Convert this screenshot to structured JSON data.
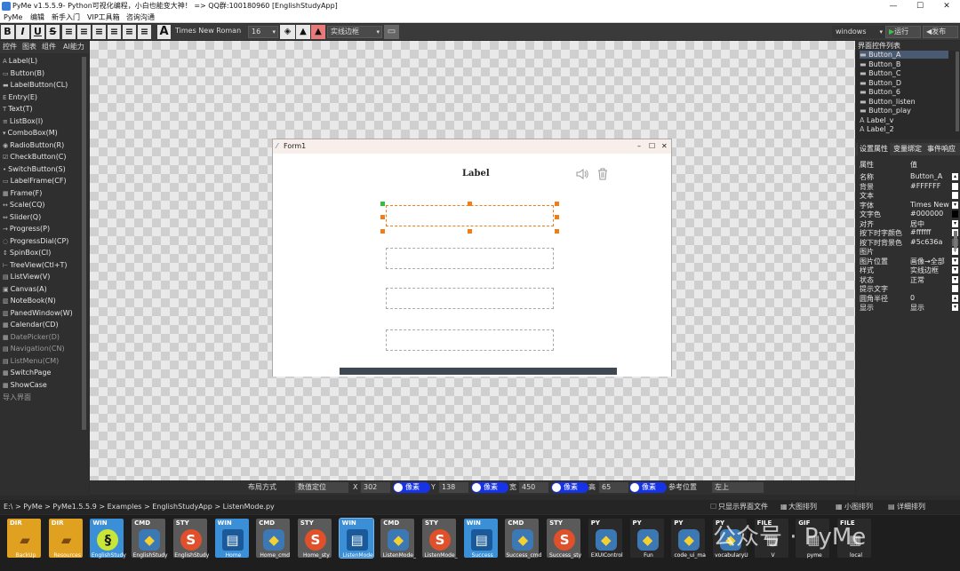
{
  "window": {
    "title": "PyMe v1.5.5.9- Python可视化编程，小白也能变大神！ => QQ群:100180960    [EnglishStudyApp]",
    "min": "—",
    "max": "☐",
    "close": "✕"
  },
  "menu": [
    "PyMe",
    "编辑",
    "新手入门",
    "VIP工具箱",
    "咨询沟通"
  ],
  "toolbar": {
    "format_buttons": [
      "B",
      "I",
      "U",
      "S",
      "≡",
      "≡",
      "≡",
      "≡",
      "≡",
      "≡",
      "A"
    ],
    "font": "Times New Roman",
    "size": "16",
    "border": "实线边框",
    "platform": "windows",
    "run": "运行",
    "publish": "发布"
  },
  "left_tabs": [
    "控件",
    "图表",
    "组件",
    "AI能力"
  ],
  "controls": [
    {
      "icon": "A",
      "label": "Label(L)"
    },
    {
      "icon": "▭",
      "label": "Button(B)"
    },
    {
      "icon": "▬",
      "label": "LabelButton(CL)"
    },
    {
      "icon": "E",
      "label": "Entry(E)"
    },
    {
      "icon": "T",
      "label": "Text(T)"
    },
    {
      "icon": "≡",
      "label": "ListBox(I)"
    },
    {
      "icon": "▾",
      "label": "ComboBox(M)"
    },
    {
      "icon": "◉",
      "label": "RadioButton(R)"
    },
    {
      "icon": "☑",
      "label": "CheckButton(C)"
    },
    {
      "icon": "•",
      "label": "SwitchButton(S)"
    },
    {
      "icon": "▭",
      "label": "LabelFrame(CF)"
    },
    {
      "icon": "▦",
      "label": "Frame(F)"
    },
    {
      "icon": "↔",
      "label": "Scale(CQ)"
    },
    {
      "icon": "⇔",
      "label": "Slider(Q)"
    },
    {
      "icon": "→",
      "label": "Progress(P)"
    },
    {
      "icon": "◌",
      "label": "ProgressDial(CP)"
    },
    {
      "icon": "↕",
      "label": "SpinBox(CI)"
    },
    {
      "icon": "⊢",
      "label": "TreeView(Ctl+T)"
    },
    {
      "icon": "▤",
      "label": "ListView(V)"
    },
    {
      "icon": "▣",
      "label": "Canvas(A)"
    },
    {
      "icon": "▥",
      "label": "NoteBook(N)"
    },
    {
      "icon": "▥",
      "label": "PanedWindow(W)"
    },
    {
      "icon": "▦",
      "label": "Calendar(CD)"
    },
    {
      "icon": "▦",
      "label": "DatePicker(D)",
      "dim": true
    },
    {
      "icon": "▤",
      "label": "Navigation(CN)",
      "dim": true
    },
    {
      "icon": "▤",
      "label": "ListMenu(CM)",
      "dim": true
    },
    {
      "icon": "▦",
      "label": "SwitchPage"
    },
    {
      "icon": "▦",
      "label": "ShowCase"
    }
  ],
  "import_label": "导入界面",
  "form": {
    "title": "Form1",
    "min": "–",
    "max": "☐",
    "close": "✕",
    "label": "Label"
  },
  "right": {
    "tree_title": "界面控件列表",
    "tree": [
      "Button_A",
      "Button_B",
      "Button_C",
      "Button_D",
      "Button_6",
      "Button_listen",
      "Button_play",
      "Label_v",
      "Label_2"
    ],
    "tabs": [
      "设置属性",
      "变量绑定",
      "事件响应"
    ],
    "head": [
      "属性",
      "值"
    ],
    "props": [
      [
        "名称",
        "Button_A"
      ],
      [
        "背景",
        "#FFFFFF"
      ],
      [
        "文本",
        ""
      ],
      [
        "字体",
        "Times New"
      ],
      [
        "文字色",
        "#000000"
      ],
      [
        "对齐",
        "居中"
      ],
      [
        "按下时字颜色",
        "#ffffff"
      ],
      [
        "按下时背景色",
        "#5c636a"
      ],
      [
        "图片",
        ""
      ],
      [
        "图片位置",
        "画像→全部"
      ],
      [
        "样式",
        "实线边框"
      ],
      [
        "状态",
        "正常"
      ],
      [
        "提示文字",
        ""
      ],
      [
        "圆角半径",
        "0"
      ],
      [
        "显示",
        "显示"
      ]
    ]
  },
  "bottom": {
    "layout": "布局方式",
    "layout_value": "数值定位",
    "x_label": "X",
    "x": "302",
    "unit": "像素",
    "y_label": "Y",
    "y": "138",
    "w_label": "宽",
    "w": "450",
    "h_label": "高",
    "h": "65",
    "ref_label": "参考位置",
    "ref": "左上"
  },
  "path": {
    "crumb": "E:\\ > PyMe > PyMe1.5.5.9 > Examples > EnglishStudyApp > ListenMode.py",
    "opt1": "只显示界面文件",
    "opt2": "大图排列",
    "opt3": "小图排列",
    "opt4": "详细排列"
  },
  "files": [
    {
      "type": "DIR",
      "name": "BackUp",
      "color": "#e0a020",
      "icon": "folder"
    },
    {
      "type": "DIR",
      "name": "Resources",
      "color": "#e0a020",
      "icon": "folder"
    },
    {
      "type": "WIN",
      "name": "EnglishStudy",
      "color": "#3a8fd6",
      "icon": "snake"
    },
    {
      "type": "CMD",
      "name": "EnglishStudy",
      "color": "#5a5a5a",
      "icon": "python"
    },
    {
      "type": "STY",
      "name": "EnglishStudy",
      "color": "#5a5a5a",
      "icon": "sty"
    },
    {
      "type": "WIN",
      "name": "Home",
      "color": "#3a8fd6",
      "icon": "window"
    },
    {
      "type": "CMD",
      "name": "Home_cmd",
      "color": "#5a5a5a",
      "icon": "python"
    },
    {
      "type": "STY",
      "name": "Home_sty",
      "color": "#5a5a5a",
      "icon": "sty"
    },
    {
      "type": "WIN",
      "name": "ListenMode",
      "color": "#3a8fd6",
      "icon": "window"
    },
    {
      "type": "CMD",
      "name": "ListenMode_",
      "color": "#5a5a5a",
      "icon": "python"
    },
    {
      "type": "STY",
      "name": "ListenMode_",
      "color": "#5a5a5a",
      "icon": "sty"
    },
    {
      "type": "WIN",
      "name": "Success",
      "color": "#3a8fd6",
      "icon": "window"
    },
    {
      "type": "CMD",
      "name": "Success_cmd",
      "color": "#5a5a5a",
      "icon": "python"
    },
    {
      "type": "STY",
      "name": "Success_sty",
      "color": "#5a5a5a",
      "icon": "sty"
    },
    {
      "type": "PY",
      "name": "EXUIControl",
      "color": "#2a2a2a",
      "icon": "python"
    },
    {
      "type": "PY",
      "name": "Fun",
      "color": "#2a2a2a",
      "icon": "python"
    },
    {
      "type": "PY",
      "name": "code_ui_ma",
      "color": "#2a2a2a",
      "icon": "python"
    },
    {
      "type": "PY",
      "name": "vocabularyU",
      "color": "#2a2a2a",
      "icon": "python"
    },
    {
      "type": "FILE",
      "name": "V",
      "color": "#2a2a2a",
      "icon": "file"
    },
    {
      "type": "GIF",
      "name": "pyme",
      "color": "#2a2a2a",
      "icon": "file"
    },
    {
      "type": "FILE",
      "name": "local",
      "color": "#2a2a2a",
      "icon": "file"
    }
  ],
  "watermark": "公众号 · PyMe"
}
